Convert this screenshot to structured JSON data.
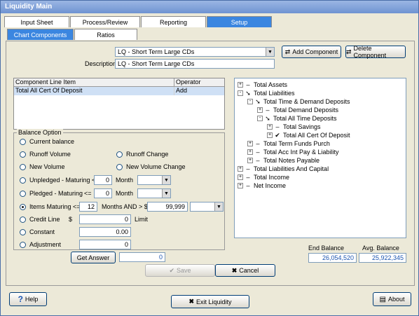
{
  "window": {
    "title": "Liquidity Main"
  },
  "tabs": [
    {
      "label": "Input Sheet",
      "active": false
    },
    {
      "label": "Process/Review",
      "active": false
    },
    {
      "label": "Reporting",
      "active": false
    },
    {
      "label": "Setup",
      "active": true
    }
  ],
  "subtabs": [
    {
      "label": "Chart Components",
      "active": true
    },
    {
      "label": "Ratios",
      "active": false
    }
  ],
  "component": {
    "dropdown_value": "LQ - Short Term Large CDs",
    "description_label": "Description",
    "description_value": "LQ - Short Term Large CDs",
    "add_button": "Add Component",
    "delete_button": "Delete Component"
  },
  "line_items": {
    "headers": [
      "Component Line Item",
      "Operator"
    ],
    "rows": [
      [
        "Total All Cert Of Deposit",
        "Add"
      ]
    ]
  },
  "balance_option": {
    "title": "Balance Option",
    "current_balance": "Current balance",
    "runoff_volume": "Runoff Volume",
    "runoff_change": "Runoff Change",
    "new_volume": "New Volume",
    "new_volume_change": "New Volume Change",
    "unpledged": "Unpledged - Maturing <=",
    "unpledged_value": "0",
    "pledged": "Pledged - Maturing",
    "pledged_le": "<=",
    "pledged_value": "0",
    "month": "Month",
    "items_maturing": "Items Maturing <=",
    "items_value": "12",
    "months_and": "Months AND > $",
    "amount_value": "99,999",
    "credit_line": "Credit Line",
    "dollar": "$",
    "credit_value": "0",
    "limit": "Limit",
    "constant": "Constant",
    "constant_value": "0.00",
    "adjustment": "Adjustment",
    "adjustment_value": "0",
    "selected": "items_maturing"
  },
  "tree": [
    {
      "label": "Total Assets",
      "indent": 0,
      "exp": "+",
      "icon": "dash"
    },
    {
      "label": "Total Liabilities",
      "indent": 0,
      "exp": "-",
      "icon": "arrow"
    },
    {
      "label": "Total Time & Demand Deposits",
      "indent": 1,
      "exp": "-",
      "icon": "arrow"
    },
    {
      "label": "Total Demand Deposits",
      "indent": 2,
      "exp": "+",
      "icon": "dash"
    },
    {
      "label": "Total All Time Deposits",
      "indent": 2,
      "exp": "-",
      "icon": "arrow"
    },
    {
      "label": "Total Savings",
      "indent": 3,
      "exp": "+",
      "icon": "dash"
    },
    {
      "label": "Total All Cert Of Deposit",
      "indent": 3,
      "exp": "+",
      "icon": "check"
    },
    {
      "label": "Total  Term Funds Purch",
      "indent": 1,
      "exp": "+",
      "icon": "dash"
    },
    {
      "label": "Total Acc Int Pay & Liability",
      "indent": 1,
      "exp": "+",
      "icon": "dash"
    },
    {
      "label": "Total Notes Payable",
      "indent": 1,
      "exp": "+",
      "icon": "dash"
    },
    {
      "label": "Total Liabilities And Capital",
      "indent": 0,
      "exp": "+",
      "icon": "dash"
    },
    {
      "label": "Total Income",
      "indent": 0,
      "exp": "+",
      "icon": "dash"
    },
    {
      "label": "Net Income",
      "indent": 0,
      "exp": "+",
      "icon": "dash"
    }
  ],
  "answer": {
    "button": "Get Answer",
    "value": "0"
  },
  "balances": {
    "end_label": "End Balance",
    "end_value": "26,054,520",
    "avg_label": "Avg. Balance",
    "avg_value": "25,922,345"
  },
  "actions": {
    "save": "Save",
    "cancel": "Cancel"
  },
  "footer": {
    "help": "Help",
    "exit": "Exit Liquidity",
    "about": "About"
  },
  "colors": {
    "accent": "#3b86e0",
    "selected_row": "#cfe0f5",
    "value_text": "#1b54b0"
  }
}
